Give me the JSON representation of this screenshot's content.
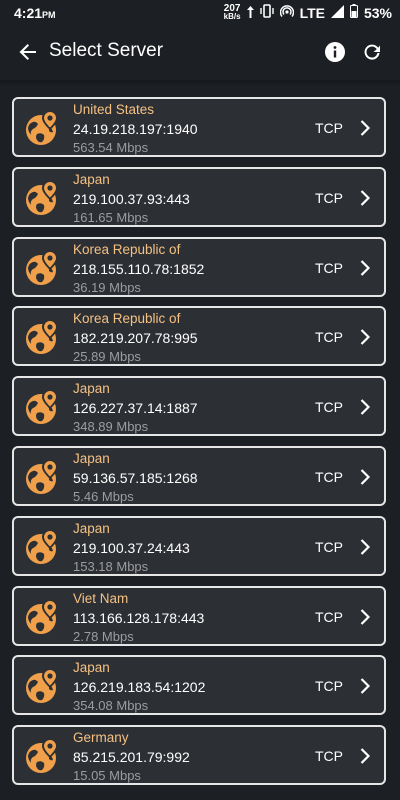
{
  "status": {
    "time": "4:21",
    "ampm": "PM",
    "speed_value": "207",
    "speed_unit": "kB/s",
    "network": "LTE",
    "battery": "53%"
  },
  "header": {
    "title": "Select Server"
  },
  "colors": {
    "accent": "#f0a04b",
    "country_text": "#f5c183",
    "card_bg": "#2c2f34",
    "page_bg": "#1c1f23"
  },
  "servers": [
    {
      "country": "United States",
      "address": "24.19.218.197:1940",
      "speed": "563.54 Mbps",
      "protocol": "TCP"
    },
    {
      "country": "Japan",
      "address": "219.100.37.93:443",
      "speed": "161.65 Mbps",
      "protocol": "TCP"
    },
    {
      "country": "Korea Republic of",
      "address": "218.155.110.78:1852",
      "speed": "36.19 Mbps",
      "protocol": "TCP"
    },
    {
      "country": "Korea Republic of",
      "address": "182.219.207.78:995",
      "speed": "25.89 Mbps",
      "protocol": "TCP"
    },
    {
      "country": "Japan",
      "address": "126.227.37.14:1887",
      "speed": "348.89 Mbps",
      "protocol": "TCP"
    },
    {
      "country": "Japan",
      "address": "59.136.57.185:1268",
      "speed": "5.46 Mbps",
      "protocol": "TCP"
    },
    {
      "country": "Japan",
      "address": "219.100.37.24:443",
      "speed": "153.18 Mbps",
      "protocol": "TCP"
    },
    {
      "country": "Viet Nam",
      "address": "113.166.128.178:443",
      "speed": "2.78 Mbps",
      "protocol": "TCP"
    },
    {
      "country": "Japan",
      "address": "126.219.183.54:1202",
      "speed": "354.08 Mbps",
      "protocol": "TCP"
    },
    {
      "country": "Germany",
      "address": "85.215.201.79:992",
      "speed": "15.05 Mbps",
      "protocol": "TCP"
    }
  ]
}
